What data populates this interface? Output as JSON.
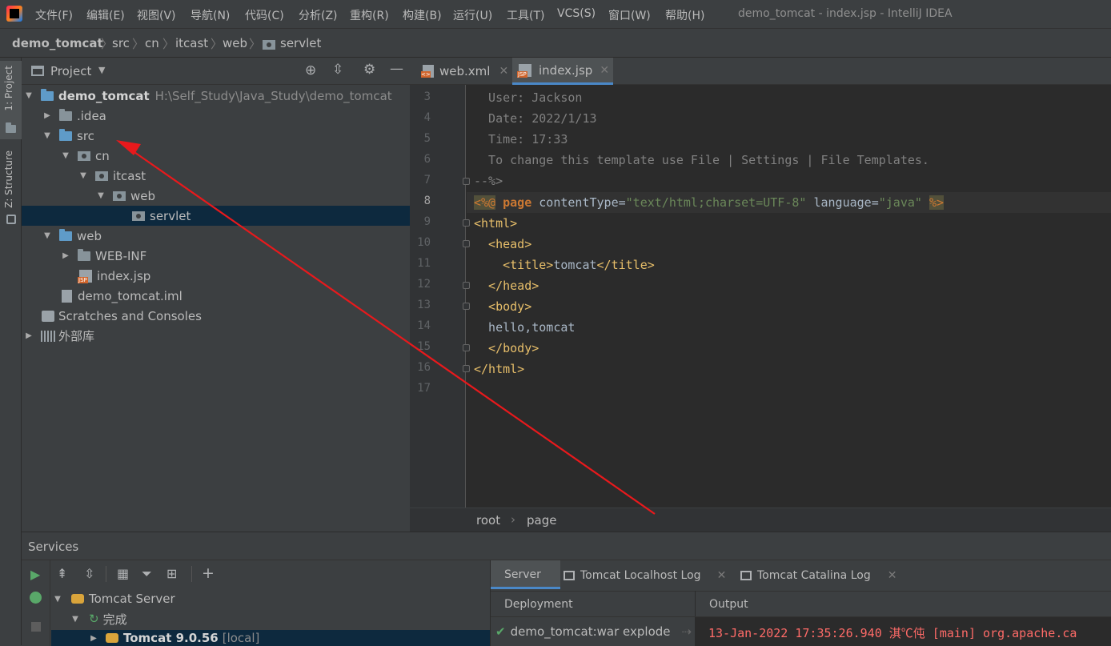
{
  "menubar": {
    "items": [
      "文件(F)",
      "编辑(E)",
      "视图(V)",
      "导航(N)",
      "代码(C)",
      "分析(Z)",
      "重构(R)",
      "构建(B)",
      "运行(U)",
      "工具(T)",
      "VCS(S)",
      "窗口(W)",
      "帮助(H)"
    ],
    "window_title": "demo_tomcat - index.jsp - IntelliJ IDEA"
  },
  "breadcrumb": [
    "demo_tomcat",
    "src",
    "cn",
    "itcast",
    "web",
    "servlet"
  ],
  "side_tabs": {
    "project": "1: Project",
    "structure": "Z: Structure"
  },
  "project_panel": {
    "title": "Project",
    "root_name": "demo_tomcat",
    "root_path": "H:\\Self_Study\\Java_Study\\demo_tomcat",
    "nodes": [
      ".idea",
      "src",
      "cn",
      "itcast",
      "web",
      "servlet",
      "web",
      "WEB-INF",
      "index.jsp",
      "demo_tomcat.iml",
      "Scratches and Consoles",
      "外部库"
    ]
  },
  "editor": {
    "tabs": [
      "web.xml",
      "index.jsp"
    ],
    "line_numbers": [
      "3",
      "4",
      "5",
      "6",
      "7",
      "8",
      "9",
      "10",
      "11",
      "12",
      "13",
      "14",
      "15",
      "16",
      "17"
    ],
    "current_line": "8",
    "comment_lines": [
      "  User: Jackson",
      "  Date: 2022/1/13",
      "  Time: 17:33",
      "  To change this template use File | Settings | File Templates.",
      "--%>"
    ],
    "directive": {
      "open": "<%@",
      "page": "page",
      "attr1": " contentType=",
      "val1": "\"text/html;charset=UTF-8\"",
      "attr2": " language=",
      "val2": "\"java\"",
      "close": "%>"
    },
    "html_lines": [
      "<html>",
      "  <head>",
      "    <title>",
      "tomcat",
      "</title>",
      "  </head>",
      "  <body>",
      "  hello,tomcat",
      "  </body>",
      "</html>"
    ],
    "footer_crumbs": [
      "root",
      "page"
    ]
  },
  "services": {
    "title": "Services",
    "tree": [
      "Tomcat Server",
      "完成",
      "Tomcat 9.0.56",
      "[local]"
    ],
    "right_tabs": [
      "Server",
      "Tomcat Localhost Log",
      "Tomcat Catalina Log"
    ],
    "deployment_header": "Deployment",
    "output_header": "Output",
    "deployment_item": "demo_tomcat:war explode",
    "output_line": "13-Jan-2022 17:35:26.940 淇℃伅 [main] org.apache.ca"
  },
  "colors": {
    "annotation_arrow": "#e8191c",
    "accent": "#4a88c7"
  }
}
